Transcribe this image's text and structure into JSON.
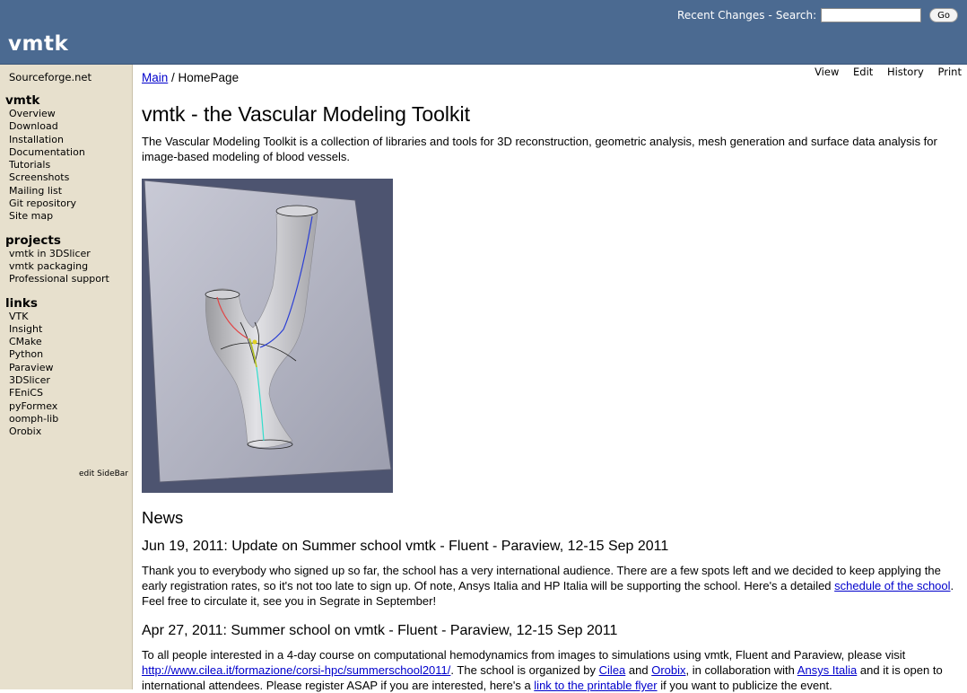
{
  "header": {
    "logo": "vmtk",
    "recent_changes": "Recent Changes",
    "separator": "-",
    "search_label": "Search:",
    "search_value": "",
    "go_label": "Go"
  },
  "sidebar": {
    "top_link": "Sourceforge.net",
    "sections": [
      {
        "title": "vmtk",
        "items": [
          "Overview",
          "Download",
          "Installation",
          "Documentation",
          "Tutorials",
          "Screenshots",
          "Mailing list",
          "Git repository",
          "Site map"
        ]
      },
      {
        "title": "projects",
        "items": [
          "vmtk in 3DSlicer",
          "vmtk packaging",
          "Professional support"
        ]
      },
      {
        "title": "links",
        "items": [
          "VTK",
          "Insight",
          "CMake",
          "Python",
          "Paraview",
          "3DSlicer",
          "FEniCS",
          "pyFormex",
          "oomph-lib",
          "Orobix"
        ]
      }
    ],
    "edit_label": "edit SideBar"
  },
  "page_actions": [
    "View",
    "Edit",
    "History",
    "Print"
  ],
  "breadcrumb": {
    "main": "Main",
    "separator": " / ",
    "current": "HomePage"
  },
  "page_title": "vmtk - the Vascular Modeling Toolkit",
  "intro": "The Vascular Modeling Toolkit is a collection of libraries and tools for 3D reconstruction, geometric analysis, mesh generation and surface data analysis for image-based modeling of blood vessels.",
  "news": {
    "title": "News",
    "items": [
      {
        "heading": "Jun 19, 2011: Update on Summer school vmtk - Fluent - Paraview, 12-15 Sep 2011",
        "text1": "Thank you to everybody who signed up so far, the school has a very international audience. There are a few spots left and we decided to keep applying the early registration rates, so it's not too late to sign up. Of note, Ansys Italia and HP Italia will be supporting the school. Here's a detailed ",
        "link1": "schedule of the school",
        "text2": ". Feel free to circulate it, see you in Segrate in September!"
      },
      {
        "heading": "Apr 27, 2011: Summer school on vmtk - Fluent - Paraview, 12-15 Sep 2011",
        "text1": "To all people interested in a 4-day course on computational hemodynamics from images to simulations using vmtk, Fluent and Paraview, please visit ",
        "link1": "http://www.cilea.it/formazione/corsi-hpc/summerschool2011/",
        "text2": ". The school is organized by ",
        "link2": "Cilea",
        "text3": " and ",
        "link3": "Orobix",
        "text4": ", in collaboration with ",
        "link4": "Ansys Italia",
        "text5": " and it is open to international attendees. Please register ASAP if you are interested, here's a ",
        "link5": "link to the printable flyer",
        "text6": " if you want to publicize the event."
      }
    ]
  },
  "colors": {
    "header_bg": "#4b6a91",
    "sidebar_bg": "#e7e0cd",
    "link": "#0000cc"
  }
}
